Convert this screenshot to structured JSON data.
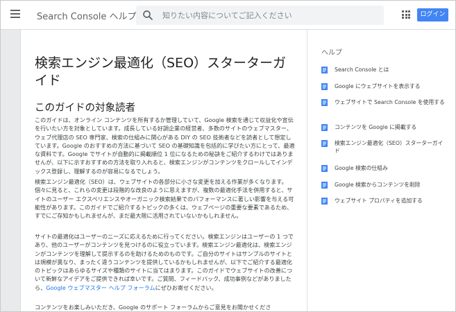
{
  "header": {
    "title": "Search Console ヘルプ",
    "search_placeholder": "知りたい内容についてご記入ください",
    "login_label": "ログイン"
  },
  "article": {
    "title": "検索エンジン最適化（SEO）スターターガイド",
    "section_title": "このガイドの対象読者",
    "p1": "このガイドは、オンライン コンテンツを所有するか管理していて、Google 検索を通じて収益化や宣伝を行いたい方を対象としています。成長している好調企業の経営者、多数のサイトのウェブマスター、ウェブ代理店の SEO 専門家、検索の仕組みに関心がある DIY の SEO 技術者などを読者として想定しています。Google のおすすめの方法に基づいて SEO の基礎知識を包括的に学びたい方にとって、最適な資料です。Google でサイトが自動的に掲載順位 1 位になるための秘訣をご紹介するわけではありませんが、以下に示すおすすめの方法を取り入れると、検索エンジンがコンテンツをクロールしてインデックス登録し、理解するのが容易になるでしょう。",
    "p2": "検索エンジン最適化（SEO）は、ウェブサイトの各部分に小さな変更を加える作業が多くなります。個々に見ると、これらの変更は段階的な改良のように思えますが、複数の最適化手法を併用すると、サイトのユーザー エクスペリエンスやオーガニック検索結果でのパフォーマンスに著しい影響を与える可能性があります。このガイドでご紹介するトピックの多くは、ウェブページの重要な要素であるため、すでにご存知かもしれませんが、まだ最大限に活用されていないかもしれません。",
    "p3_text": "サイトの最適化はユーザーのニーズに応えるために行ってください。検索エンジンはユーザーの 1 つであり、他のユーザーがコンテンツを見つけるのに役立っています。検索エンジン最適化は、検索エンジンがコンテンツを理解して提示するのを助けるためのものです。ご自分のサイトはサンプルのサイトとは規模が異なり、まったく違うコンテンツを提供しているかもしれませんが、以下でご紹介する最適化のトピックはあらゆるサイズや種類のサイトに当てはまります。このガイドでウェブサイトの改善について新鮮なアイデアをご提供できれば幸いです。ご質問、フィードバック、成功事例などがありましたら、",
    "p3_link": "Google ウェブマスター ヘルプ フォーラム",
    "p3_end": "にぜひお寄せください。",
    "p4": "コンテンツをお楽しみいただき、Google のサポート フォーラムからご意見をお聞かせくださ"
  },
  "sidebar": {
    "heading": "ヘルプ",
    "items": [
      {
        "label": "Search Console とは"
      },
      {
        "label": "Google にウェブサイトを表示する"
      },
      {
        "label": "ウェブサイトで Search Console を使用する"
      },
      {
        "label": "コンテンツを Google に掲載する"
      },
      {
        "label": "検索エンジン最適化（SEO）スターターガイド"
      },
      {
        "label": "Google 検索の仕組み"
      },
      {
        "label": "Google 検索からコンテンツを削除"
      },
      {
        "label": "ウェブサイト プロパティを追加する"
      }
    ]
  },
  "colors": {
    "accent": "#4285f4",
    "doc_icon": "#4285f4",
    "link": "#1a73e8"
  },
  "icons": [
    "menu-icon",
    "search-icon",
    "apps-grid-icon",
    "document-icon"
  ]
}
